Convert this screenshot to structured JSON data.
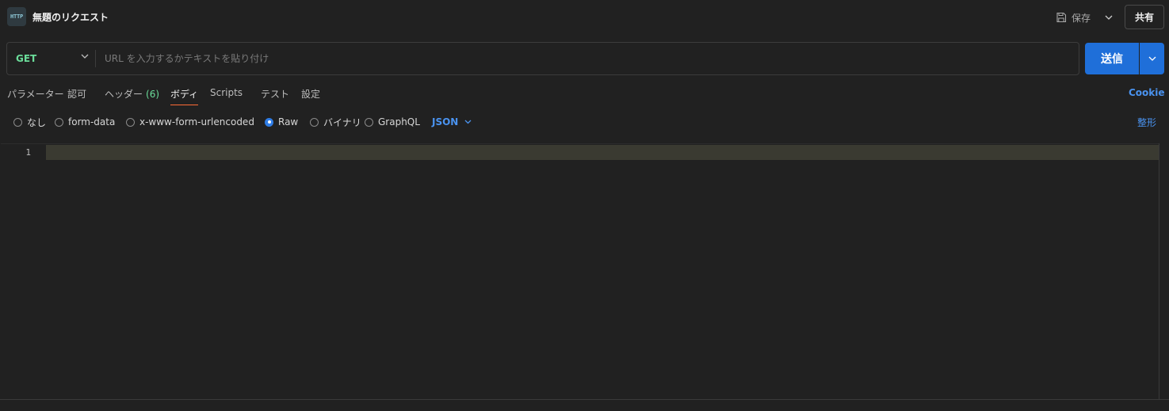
{
  "header": {
    "badge": "HTTP",
    "title": "無題のリクエスト",
    "save_label": "保存",
    "share_label": "共有"
  },
  "request": {
    "method": "GET",
    "url_value": "",
    "url_placeholder": "URL を入力するかテキストを貼り付け",
    "send_label": "送信"
  },
  "tabs": [
    {
      "label": "パラメーター"
    },
    {
      "label": "認可"
    },
    {
      "label": "ヘッダー",
      "count": "(6)"
    },
    {
      "label": "ボディ",
      "active": true
    },
    {
      "label": "Scripts"
    },
    {
      "label": "テスト"
    },
    {
      "label": "設定"
    }
  ],
  "cookie_label": "Cookie",
  "body_types": [
    {
      "label": "なし",
      "checked": false
    },
    {
      "label": "form-data",
      "checked": false
    },
    {
      "label": "x-www-form-urlencoded",
      "checked": false
    },
    {
      "label": "Raw",
      "checked": true
    },
    {
      "label": "バイナリ",
      "checked": false
    },
    {
      "label": "GraphQL",
      "checked": false
    }
  ],
  "raw_language": "JSON",
  "beautify_label": "整形",
  "editor": {
    "line_numbers": [
      "1"
    ],
    "content": ""
  },
  "colors": {
    "accent": "#1f6fd9",
    "method_get": "#6bdd9a",
    "link": "#4a93f0",
    "active_tab_underline": "#ff6c37"
  }
}
